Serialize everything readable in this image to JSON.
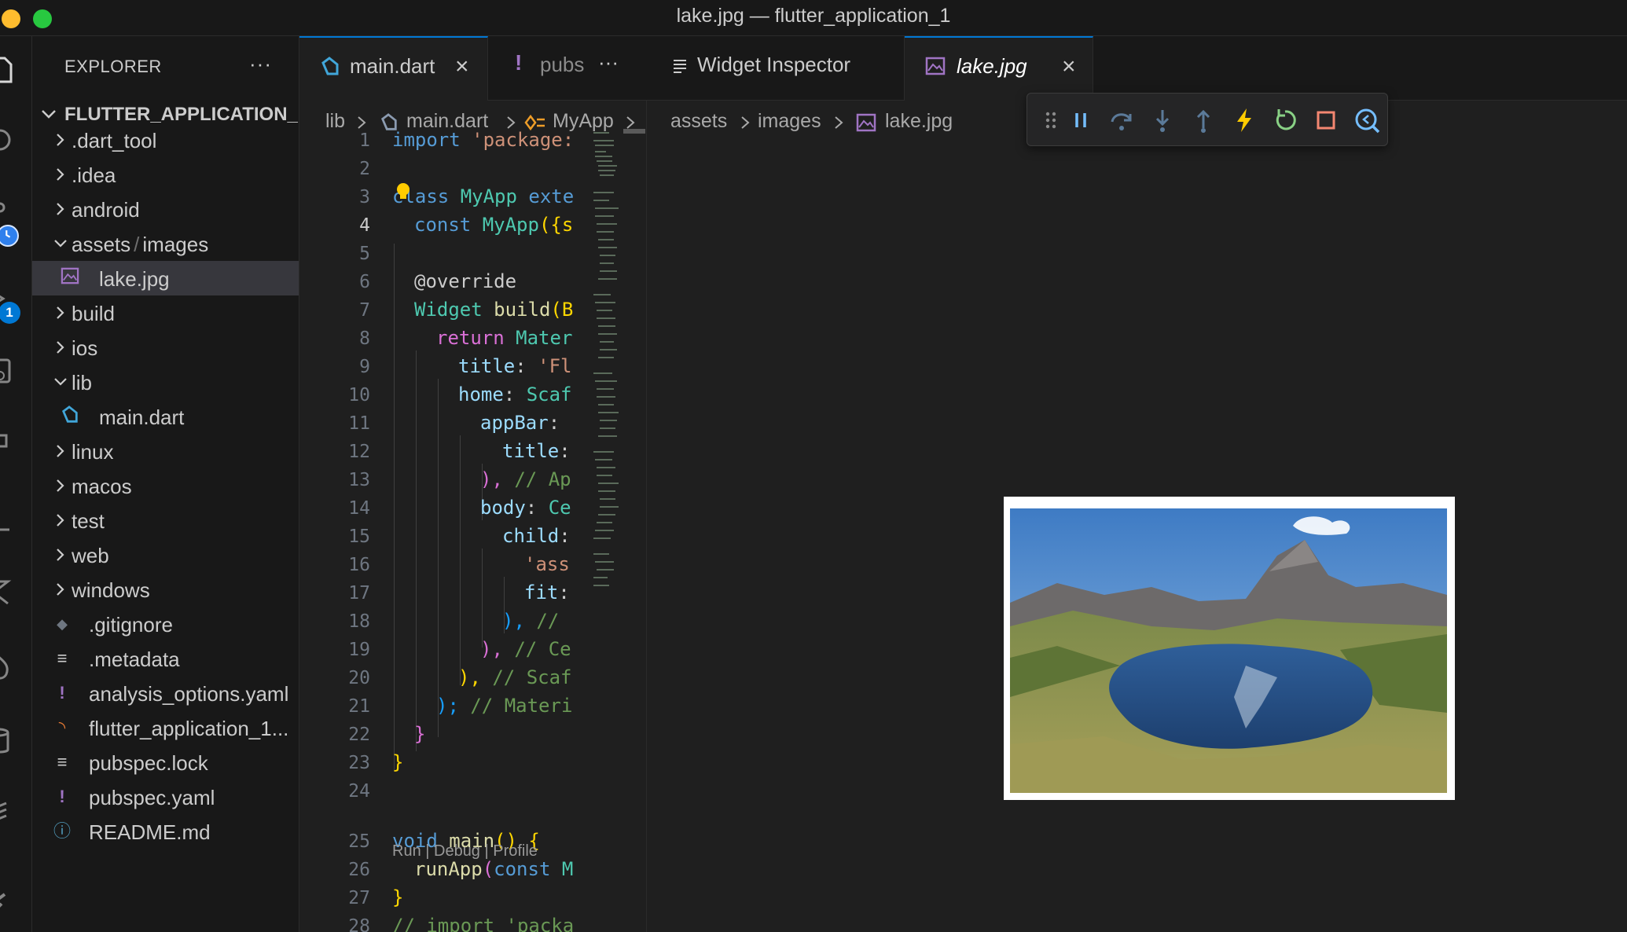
{
  "window": {
    "title": "lake.jpg — flutter_application_1",
    "traffic_colors": [
      "#febc2e",
      "#28c840"
    ]
  },
  "activity_bar": {
    "badge_count": "1",
    "icons": [
      "files-icon",
      "search-icon",
      "source-control-icon",
      "run-debug-icon",
      "remote-explorer-icon",
      "extensions-icon",
      "testing-icon",
      "flutter-icon",
      "flame-icon",
      "database-icon",
      "layers-icon",
      "wrench-icon"
    ]
  },
  "sidebar": {
    "title": "EXPLORER",
    "more": "···",
    "project": "FLUTTER_APPLICATION_1",
    "items": [
      {
        "label": ".dart_tool",
        "type": "folder",
        "expanded": false,
        "icon": "chevron-right-icon"
      },
      {
        "label": ".idea",
        "type": "folder",
        "expanded": false,
        "icon": "chevron-right-icon"
      },
      {
        "label": "android",
        "type": "folder",
        "expanded": false,
        "icon": "chevron-right-icon"
      },
      {
        "label_a": "assets",
        "label_sep": "/",
        "label_b": "images",
        "type": "folder",
        "expanded": true,
        "icon": "chevron-down-icon"
      },
      {
        "label": "lake.jpg",
        "type": "image",
        "selected": true,
        "icon": "image-file-icon"
      },
      {
        "label": "build",
        "type": "folder",
        "expanded": false,
        "icon": "chevron-right-icon"
      },
      {
        "label": "ios",
        "type": "folder",
        "expanded": false,
        "icon": "chevron-right-icon"
      },
      {
        "label": "lib",
        "type": "folder",
        "expanded": true,
        "icon": "chevron-down-icon"
      },
      {
        "label": "main.dart",
        "type": "dart",
        "icon": "dart-file-icon"
      },
      {
        "label": "linux",
        "type": "folder",
        "expanded": false,
        "icon": "chevron-right-icon"
      },
      {
        "label": "macos",
        "type": "folder",
        "expanded": false,
        "icon": "chevron-right-icon"
      },
      {
        "label": "test",
        "type": "folder",
        "expanded": false,
        "icon": "chevron-right-icon"
      },
      {
        "label": "web",
        "type": "folder",
        "expanded": false,
        "icon": "chevron-right-icon"
      },
      {
        "label": "windows",
        "type": "folder",
        "expanded": false,
        "icon": "chevron-right-icon"
      },
      {
        "label": ".gitignore",
        "type": "git",
        "icon": "git-file-icon"
      },
      {
        "label": ".metadata",
        "type": "text",
        "icon": "lines-file-icon"
      },
      {
        "label": "analysis_options.yaml",
        "type": "yaml",
        "icon": "yaml-file-icon"
      },
      {
        "label": "flutter_application_1...",
        "type": "rss",
        "icon": "rss-file-icon"
      },
      {
        "label": "pubspec.lock",
        "type": "text",
        "icon": "lines-file-icon"
      },
      {
        "label": "pubspec.yaml",
        "type": "yaml",
        "icon": "yaml-file-icon"
      },
      {
        "label": "README.md",
        "type": "info",
        "icon": "info-file-icon"
      }
    ]
  },
  "editor_left": {
    "tabs": [
      {
        "label": "main.dart",
        "close": "×",
        "icon": "dart-file-icon"
      },
      {
        "label": "pubs",
        "more": "···",
        "icon": "yaml-file-icon"
      }
    ],
    "breadcrumb": [
      "lib",
      "main.dart",
      "MyApp"
    ],
    "current_line": "4",
    "code_lens": "Run | Debug | Profile",
    "line_numbers": [
      "1",
      "2",
      "3",
      "4",
      "5",
      "6",
      "7",
      "8",
      "9",
      "10",
      "11",
      "12",
      "13",
      "14",
      "15",
      "16",
      "17",
      "18",
      "19",
      "20",
      "21",
      "22",
      "23",
      "24",
      "25",
      "26",
      "27",
      "28"
    ],
    "code": {
      "l1": [
        "import",
        " 'package:"
      ],
      "l3": [
        "class",
        " MyApp",
        " exte"
      ],
      "l4": [
        "const",
        " MyApp",
        "({s"
      ],
      "l6": [
        "@override"
      ],
      "l7": [
        "Widget",
        " build",
        "(B"
      ],
      "l8": [
        "return",
        " Mater"
      ],
      "l9": [
        "title",
        ": ",
        "'Fl"
      ],
      "l10": [
        "home",
        ": ",
        "Scaf"
      ],
      "l11": [
        "appBar",
        ":"
      ],
      "l12": [
        "title",
        ":"
      ],
      "l13": [
        "),",
        " // Ap"
      ],
      "l14": [
        "body",
        ": ",
        "Ce"
      ],
      "l15": [
        "child",
        ":"
      ],
      "l16": [
        "'ass"
      ],
      "l17": [
        "fit",
        ":"
      ],
      "l18": [
        "),",
        " //"
      ],
      "l19": [
        "),",
        " // Ce"
      ],
      "l20": [
        "),",
        " // Scaf"
      ],
      "l21": [
        ");",
        " // Materi"
      ],
      "l22": [
        "}"
      ],
      "l23": [
        "}"
      ],
      "l25": [
        "void",
        " main",
        "()",
        " {"
      ],
      "l26": [
        "runApp",
        "(",
        "const",
        " M"
      ],
      "l27": [
        "}"
      ],
      "l28": [
        "// import 'packa"
      ]
    }
  },
  "editor_right": {
    "tabs": [
      {
        "label": "Widget Inspector",
        "icon": "lines-file-icon"
      },
      {
        "label": "lake.jpg",
        "close": "×",
        "icon": "image-file-icon",
        "active": true
      }
    ],
    "breadcrumb": [
      "assets",
      "images",
      "lake.jpg"
    ],
    "debug_toolbar": [
      "gripper-icon",
      "pause-icon",
      "step-over-icon",
      "step-into-icon",
      "step-out-icon",
      "hot-reload-icon",
      "hot-restart-icon",
      "stop-icon",
      "widget-inspect-icon"
    ],
    "image_alt": "lake.jpg"
  },
  "colors": {
    "accent": "#0078d4",
    "pause": "#75beff",
    "hot_reload": "#ffcc00",
    "restart": "#89d185",
    "stop": "#f48771",
    "yaml_icon": "#a074c4",
    "dart_icon": "#41a6d9",
    "rss_icon": "#e37933",
    "info_icon": "#519aba"
  }
}
